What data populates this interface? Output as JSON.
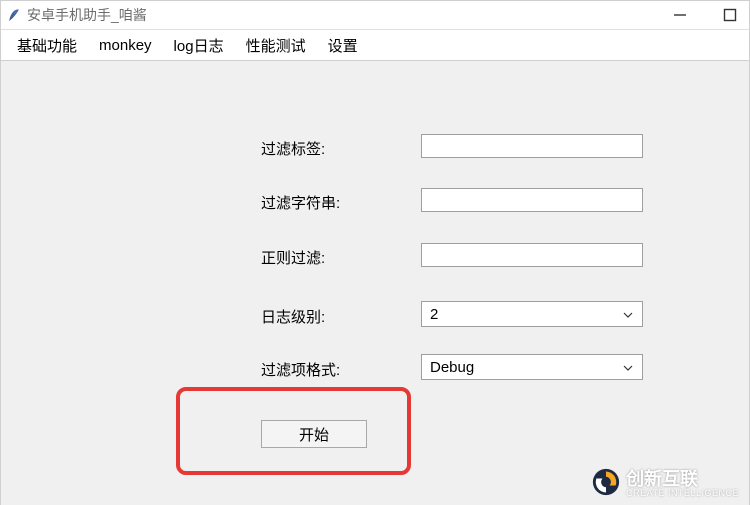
{
  "window": {
    "title": "安卓手机助手_咱酱"
  },
  "menu": {
    "basic": "基础功能",
    "monkey": "monkey",
    "log": "log日志",
    "perf": "性能测试",
    "settings": "设置"
  },
  "form": {
    "filter_tag_label": "过滤标签:",
    "filter_string_label": "过滤字符串:",
    "regex_filter_label": "正则过滤:",
    "log_level_label": "日志级别:",
    "log_level_value": "2",
    "filter_format_label": "过滤项格式:",
    "filter_format_value": "Debug",
    "start_button": "开始"
  },
  "watermark": {
    "brand": "创新互联",
    "sub": "CREATE INTELLIGENCE"
  }
}
